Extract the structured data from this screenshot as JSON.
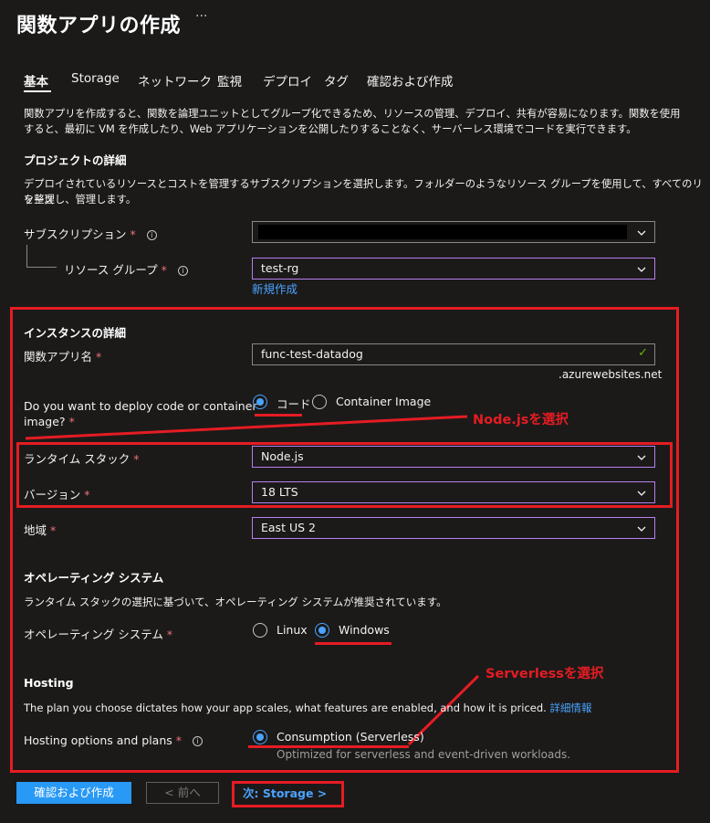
{
  "header": {
    "title": "関数アプリの作成",
    "more": "···"
  },
  "tabs": [
    {
      "label": "基本",
      "active": true
    },
    {
      "label": "Storage"
    },
    {
      "label": "ネットワーク"
    },
    {
      "label": "監視"
    },
    {
      "label": "デプロイ"
    },
    {
      "label": "タグ"
    },
    {
      "label": "確認および作成"
    }
  ],
  "intro": {
    "line1": "関数アプリを作成すると、関数を論理ユニットとしてグループ化できるため、リソースの管理、デプロイ、共有が容易になります。関数を使用",
    "line2": "すると、最初に VM を作成したり、Web アプリケーションを公開したりすることなく、サーバーレス環境でコードを実行できます。"
  },
  "project": {
    "title": "プロジェクトの詳細",
    "desc1": "デプロイされているリソースとコストを管理するサブスクリプションを選択します。フォルダーのようなリソース グループを使用して、すべてのリソース",
    "desc2": "を整理し、管理します。",
    "subscription_label": "サブスクリプション",
    "resource_group_label": "リソース グループ",
    "resource_group_value": "test-rg",
    "create_new_link": "新規作成"
  },
  "instance": {
    "title": "インスタンスの詳細",
    "app_name_label": "関数アプリ名",
    "app_name_value": "func-test-datadog",
    "domain_suffix": ".azurewebsites.net",
    "deploy_label_1": "Do you want to deploy code or container",
    "deploy_label_2": "image?",
    "deploy_options": [
      {
        "label": "コード",
        "selected": true
      },
      {
        "label": "Container Image",
        "selected": false
      }
    ],
    "runtime_label": "ランタイム スタック",
    "runtime_value": "Node.js",
    "version_label": "バージョン",
    "version_value": "18 LTS",
    "region_label": "地域",
    "region_value": "East US 2"
  },
  "os": {
    "title": "オペレーティング システム",
    "desc": "ランタイム スタックの選択に基づいて、オペレーティング システムが推奨されています。",
    "label": "オペレーティング システム",
    "options": [
      {
        "label": "Linux",
        "selected": false
      },
      {
        "label": "Windows",
        "selected": true
      }
    ]
  },
  "hosting": {
    "title": "Hosting",
    "desc": "The plan you choose dictates how your app scales, what features are enabled, and how it is priced.",
    "more_link": "詳細情報",
    "label": "Hosting options and plans",
    "option_label": "Consumption (Serverless)",
    "option_desc": "Optimized for serverless and event-driven workloads."
  },
  "annotations": {
    "nodejs": "Node.jsを選択",
    "serverless": "Serverlessを選択"
  },
  "footer": {
    "review_create": "確認および作成",
    "previous": "< 前へ",
    "next": "次: Storage >"
  },
  "colors": {
    "accent": "#2899f5",
    "link": "#4aa3ff",
    "required": "#f1707b",
    "annotation": "#e51c23",
    "focus_border": "#b77ff0",
    "valid": "#6bb700"
  }
}
